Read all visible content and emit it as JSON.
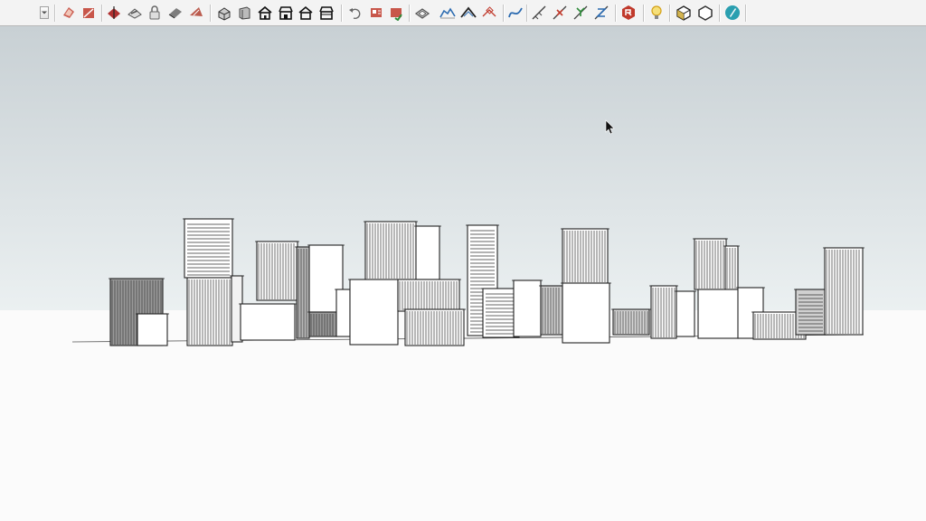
{
  "toolbar": {
    "tools": [
      {
        "icon": "styles-icon",
        "color": "#c0392b"
      },
      {
        "icon": "styles-edit-icon",
        "color": "#c0392b"
      },
      {
        "icon": "section-plane-icon",
        "color": "#b03030"
      },
      {
        "icon": "section-fill-icon",
        "color": "#555555"
      },
      {
        "icon": "padlock-icon",
        "color": "#666666"
      },
      {
        "icon": "face-style-icon",
        "color": "#555555"
      },
      {
        "icon": "shaded-icon",
        "color": "#b04030"
      },
      {
        "icon": "iso-view-icon",
        "color": "#333333"
      },
      {
        "icon": "top-view-icon",
        "color": "#444444"
      },
      {
        "icon": "front-view-icon",
        "color": "#111111"
      },
      {
        "icon": "right-view-icon",
        "color": "#111111"
      },
      {
        "icon": "back-view-icon",
        "color": "#111111"
      },
      {
        "icon": "left-view-icon",
        "color": "#111111"
      },
      {
        "icon": "undo-icon",
        "color": "#666666"
      },
      {
        "icon": "warehouse-icon",
        "color": "#c0392b"
      },
      {
        "icon": "extension-icon",
        "color": "#c0392b"
      },
      {
        "icon": "sandbox-contours-icon",
        "color": "#555555"
      },
      {
        "icon": "sandbox-scratch-icon",
        "color": "#2a6ab0"
      },
      {
        "icon": "sandbox-smoove-icon",
        "color": "#222222"
      },
      {
        "icon": "sandbox-stamp-icon",
        "color": "#c0392b"
      },
      {
        "icon": "freehand-curve-icon",
        "color": "#2a6ab0"
      },
      {
        "icon": "axis-measure-icon",
        "color": "#444444"
      },
      {
        "icon": "axis-x-icon",
        "color": "#c0392b"
      },
      {
        "icon": "axis-y-icon",
        "color": "#2e8b3a"
      },
      {
        "icon": "axis-z-icon",
        "color": "#2a6ab0"
      },
      {
        "icon": "ruby-console-icon",
        "color": "#c0392b"
      },
      {
        "icon": "lightbulb-icon",
        "color": "#d4a017"
      },
      {
        "icon": "component-icon",
        "color": "#c9a227"
      },
      {
        "icon": "outliner-icon",
        "color": "#333333"
      },
      {
        "icon": "pencil-circle-icon",
        "color": "#2a9fb0"
      }
    ]
  },
  "viewport": {
    "sky_top": "#c8d0d4",
    "sky_bottom": "#ebf0f1",
    "ground": "#fbfbfb"
  }
}
